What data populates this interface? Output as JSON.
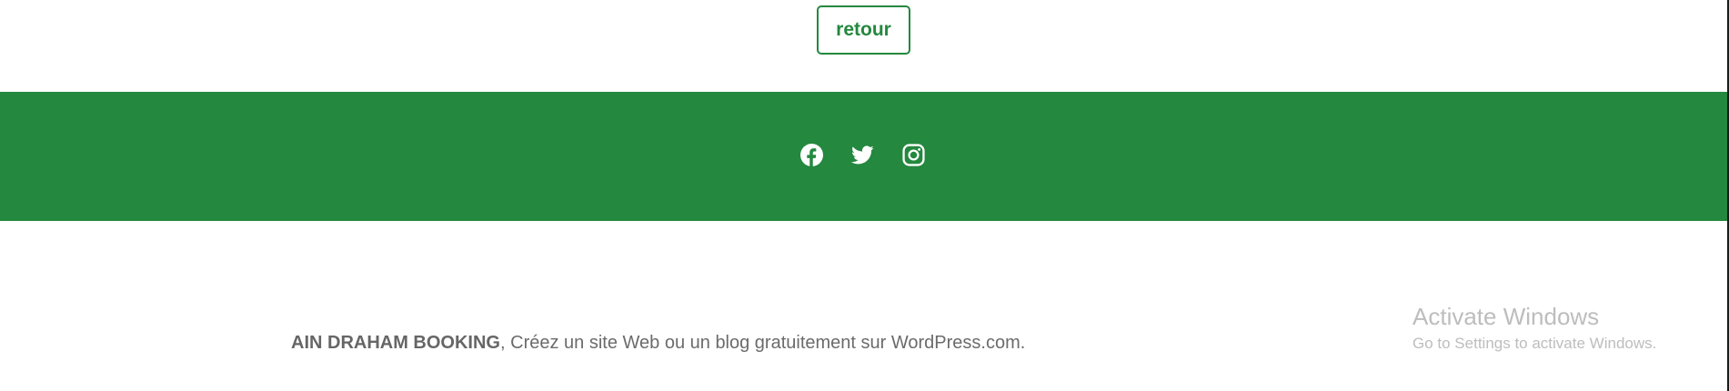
{
  "main": {
    "back_label": "retour"
  },
  "footer": {
    "band_color": "#24883f",
    "social": [
      {
        "name": "Facebook",
        "icon": "facebook-icon"
      },
      {
        "name": "Twitter",
        "icon": "twitter-icon"
      },
      {
        "name": "Instagram",
        "icon": "instagram-icon"
      }
    ],
    "site_name": "AIN DRAHAM BOOKING",
    "separator": ", ",
    "credit_text": "Créez un site Web ou un blog gratuitement sur WordPress.com",
    "period": "."
  },
  "os_overlay": {
    "title": "Activate Windows",
    "subtitle": "Go to Settings to activate Windows."
  }
}
